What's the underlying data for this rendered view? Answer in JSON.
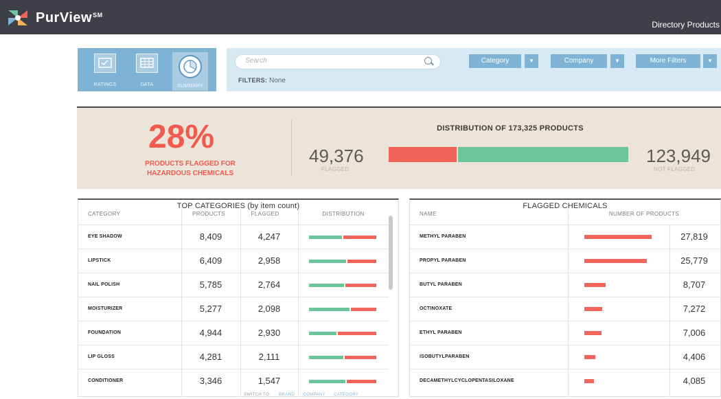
{
  "app": {
    "brand": "PurView",
    "trademark": "SM",
    "nav_text": "Directory Products"
  },
  "views": [
    {
      "label": "RATINGS",
      "icon": "ratings-icon",
      "active": false
    },
    {
      "label": "DATA",
      "icon": "data-grid-icon",
      "active": false
    },
    {
      "label": "SUMMARY",
      "icon": "summary-pie-icon",
      "active": true
    }
  ],
  "search": {
    "placeholder": "Search"
  },
  "filter_buttons": [
    {
      "label": "Category"
    },
    {
      "label": "Company"
    },
    {
      "label": "More Filters"
    }
  ],
  "filters": {
    "label": "FILTERS:",
    "value": "None"
  },
  "summary": {
    "percent": "28%",
    "percent_label_line1": "PRODUCTS FLAGGED FOR",
    "percent_label_line2": "HAZARDOUS CHEMICALS",
    "dist_title": "DISTRIBUTION OF 173,325 PRODUCTS",
    "flagged": "49,376",
    "flagged_label": "FLAGGED",
    "not_flagged": "123,949",
    "not_flagged_label": "NOT FLAGGED",
    "flagged_fraction": 0.285
  },
  "colors": {
    "flagged": "#f2635a",
    "not_flagged": "#6cc49a",
    "accent": "#7fb3d5",
    "topbar": "#3f4047"
  },
  "categories_table": {
    "title": "TOP CATEGORIES (by item count)",
    "headers": [
      "CATEGORY",
      "PRODUCTS",
      "FLAGGED",
      "DISTRIBUTION"
    ],
    "rows": [
      {
        "name": "EYE SHADOW",
        "products": "8,409",
        "flagged": "4,247",
        "green_fraction": 0.49
      },
      {
        "name": "LIPSTICK",
        "products": "6,409",
        "flagged": "2,958",
        "green_fraction": 0.55
      },
      {
        "name": "NAIL POLISH",
        "products": "5,785",
        "flagged": "2,764",
        "green_fraction": 0.52
      },
      {
        "name": "MOISTURIZER",
        "products": "5,277",
        "flagged": "2,098",
        "green_fraction": 0.6
      },
      {
        "name": "FOUNDATION",
        "products": "4,944",
        "flagged": "2,930",
        "green_fraction": 0.41
      },
      {
        "name": "LIP GLOSS",
        "products": "4,281",
        "flagged": "2,111",
        "green_fraction": 0.51
      },
      {
        "name": "CONDITIONER",
        "products": "3,346",
        "flagged": "1,547",
        "green_fraction": 0.54
      }
    ],
    "switch_label": "SWITCH TO:",
    "switch_links": [
      "BRAND",
      "COMPANY",
      "CATEGORY"
    ]
  },
  "chemicals_table": {
    "title": "FLAGGED CHEMICALS",
    "headers": [
      "NAME",
      "NUMBER OF PRODUCTS"
    ],
    "rows": [
      {
        "name": "METHYL PARABEN",
        "count": "27,819",
        "value": 27819
      },
      {
        "name": "PROPYL PARABEN",
        "count": "25,779",
        "value": 25779
      },
      {
        "name": "BUTYL PARABEN",
        "count": "8,707",
        "value": 8707
      },
      {
        "name": "OCTINOXATE",
        "count": "7,272",
        "value": 7272
      },
      {
        "name": "ETHYL PARABEN",
        "count": "7,006",
        "value": 7006
      },
      {
        "name": "ISOBUTYLPARABEN",
        "count": "4,406",
        "value": 4406
      },
      {
        "name": "DECAMETHYLCYCLOPENTASILOXANE",
        "count": "4,085",
        "value": 4085
      }
    ]
  }
}
